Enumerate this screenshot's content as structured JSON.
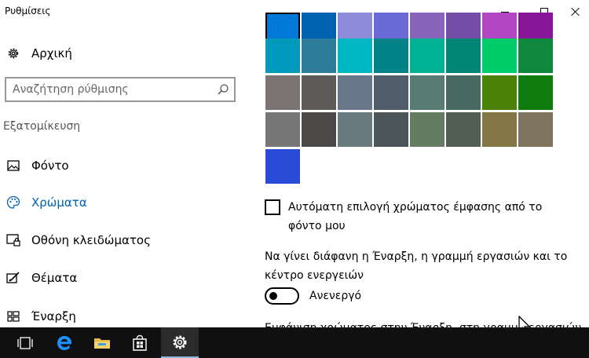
{
  "window": {
    "title": "Ρυθμίσεις"
  },
  "sidebar": {
    "home_label": "Αρχική",
    "search_placeholder": "Αναζήτηση ρύθμισης",
    "section_heading": "Εξατομίκευση",
    "items": [
      {
        "label": "Φόντο",
        "icon": "picture-icon",
        "active": false
      },
      {
        "label": "Χρώματα",
        "icon": "palette-icon",
        "active": true
      },
      {
        "label": "Οθόνη κλειδώματος",
        "icon": "lock-screen-icon",
        "active": false
      },
      {
        "label": "Θέματα",
        "icon": "themes-icon",
        "active": false
      },
      {
        "label": "Έναρξη",
        "icon": "start-icon",
        "active": false
      }
    ]
  },
  "colors": {
    "accent": "#0063b1",
    "selected_swatch": "#0078d7",
    "rows": [
      [
        "#0078d7",
        "#0063b1",
        "#8e8cd8",
        "#6b69d6",
        "#8764b8",
        "#744da9",
        "#b146c2",
        "#881798"
      ],
      [
        "#0099bc",
        "#2d7d9a",
        "#00b7c3",
        "#038387",
        "#00b294",
        "#018574",
        "#00cc6a",
        "#10893e"
      ],
      [
        "#7a7574",
        "#5d5a58",
        "#68768a",
        "#515c6b",
        "#567c73",
        "#486860",
        "#498205",
        "#107c10"
      ],
      [
        "#767676",
        "#4c4a48",
        "#69797e",
        "#4a5459",
        "#647c64",
        "#525e54",
        "#847545",
        "#7e735f"
      ],
      [
        "#2a4bd7"
      ]
    ]
  },
  "options": {
    "auto_accent_label": "Αυτόματη επιλογή χρώματος έμφασης από το φόντο μου",
    "auto_accent_checked": false,
    "transparency_label": "Να γίνει διάφανη η Έναρξη, η γραμμή εργασιών και το κέντρο ενεργειών",
    "transparency_state": "Ανενεργό",
    "cut_text": "Εμφάνιση χρώματος στην Έναρξη, στη γραμμή εργασιών"
  },
  "taskbar": {
    "items": [
      {
        "name": "task-view-icon",
        "active": false
      },
      {
        "name": "edge-icon",
        "active": false
      },
      {
        "name": "file-explorer-icon",
        "active": false
      },
      {
        "name": "store-icon",
        "active": false
      },
      {
        "name": "settings-gear-icon",
        "active": true
      }
    ]
  }
}
